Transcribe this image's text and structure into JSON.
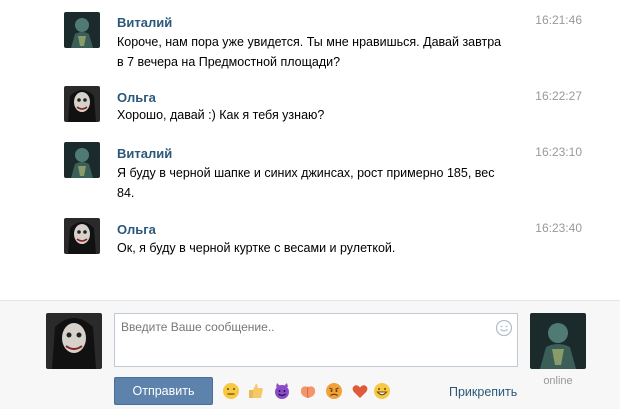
{
  "messages": [
    {
      "author": "Виталий",
      "time": "16:21:46",
      "lines": [
        "Короче, нам пора уже увидется. Ты мне нравишься. Давай завтра",
        "в 7 вечера на Предмостной площади?"
      ]
    },
    {
      "author": "Ольга",
      "time": "16:22:27",
      "lines": [
        "Хорошо, давай :) Как я тебя узнаю?"
      ]
    },
    {
      "author": "Виталий",
      "time": "16:23:10",
      "lines": [
        "Я буду в черной шапке и синих джинсах, рост примерно 185, вес",
        "84."
      ]
    },
    {
      "author": "Ольга",
      "time": "16:23:40",
      "lines": [
        "Ок, я буду в черной куртке с весами и рулеткой."
      ]
    }
  ],
  "composer": {
    "placeholder": "Введите Ваше сообщение..",
    "send_label": "Отправить",
    "attach_label": "Прикрепить",
    "status": "online",
    "emojis": [
      "neutral-face",
      "thumbs-up",
      "devil",
      "peach",
      "angry-face",
      "heart",
      "grin"
    ]
  },
  "colors": {
    "link": "#2b587a",
    "button": "#5d82ac",
    "time": "#999999"
  }
}
